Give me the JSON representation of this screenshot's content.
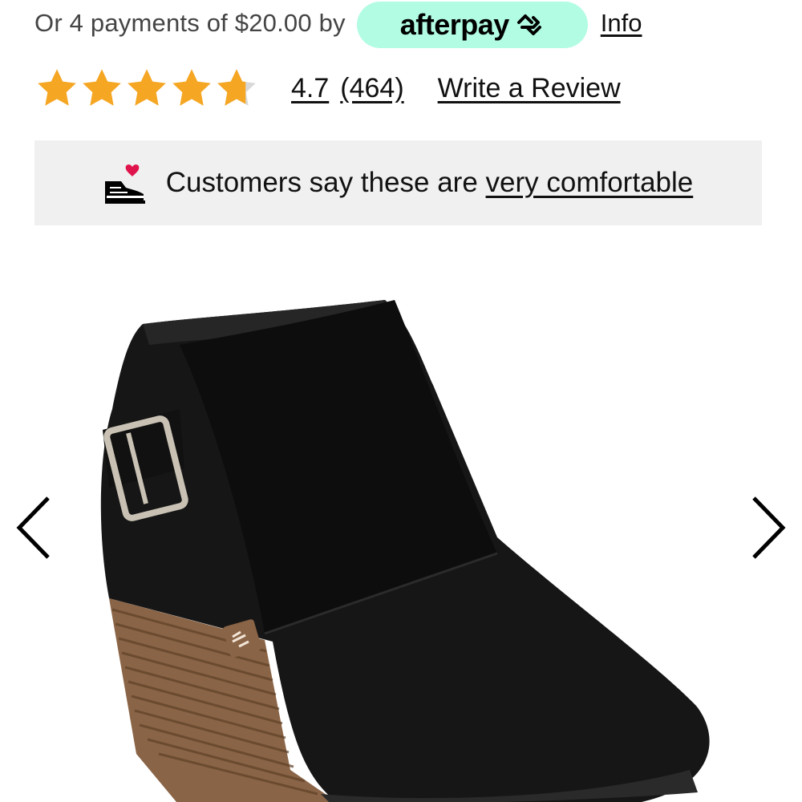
{
  "afterpay": {
    "text": "Or 4 payments of $20.00 by",
    "brand": "afterpay",
    "info_link": "Info",
    "badge_color": "#b2fce4"
  },
  "rating": {
    "value": "4.7",
    "count": "(464)",
    "stars_filled": 4.7,
    "stars_total": 5,
    "star_color": "#f5a623",
    "write_review": "Write a Review"
  },
  "comfort": {
    "prefix": "Customers say these are ",
    "link": "very comfortable",
    "icon": "sneaker-heart-icon"
  },
  "carousel": {
    "prev_icon": "chevron-left-icon",
    "next_icon": "chevron-right-icon",
    "image": "black suede wedge ankle bootie with buckle strap"
  }
}
